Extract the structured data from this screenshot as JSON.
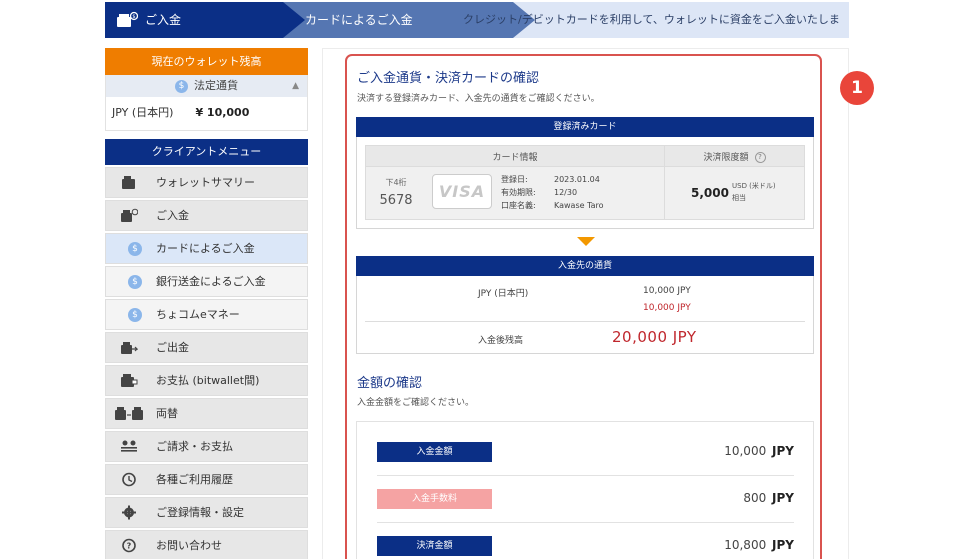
{
  "breadcrumb": {
    "step1": "ご入金",
    "step2": "カードによるご入金",
    "description": "クレジット/デビットカードを利用して、ウォレットに資金をご入金いたします"
  },
  "sidebar": {
    "balance_header": "現在のウォレット残高",
    "currency_type": "法定通貨",
    "balance_currency": "JPY (日本円)",
    "balance_amount": "¥ 10,000",
    "menu_header": "クライアントメニュー",
    "items": [
      {
        "label": "ウォレットサマリー",
        "icon": "wallet-icon"
      },
      {
        "label": "ご入金",
        "icon": "deposit-wallet-icon"
      },
      {
        "label": "カードによるご入金",
        "icon": "coin-icon"
      },
      {
        "label": "銀行送金によるご入金",
        "icon": "coin-icon"
      },
      {
        "label": "ちょコムeマネー",
        "icon": "coin-icon"
      },
      {
        "label": "ご出金",
        "icon": "withdraw-icon"
      },
      {
        "label": "お支払 (bitwallet間)",
        "icon": "transfer-icon"
      },
      {
        "label": "両替",
        "icon": "exchange-icon"
      },
      {
        "label": "ご請求・お支払",
        "icon": "users-icon"
      },
      {
        "label": "各種ご利用履歴",
        "icon": "history-icon"
      },
      {
        "label": "ご登録情報・設定",
        "icon": "gear-icon"
      },
      {
        "label": "お問い合わせ",
        "icon": "question-icon"
      }
    ]
  },
  "section1": {
    "title": "ご入金通貨・決済カードの確認",
    "desc": "決済する登録済みカード、入金先の通貨をご確認ください。",
    "card_bar": "登録済みカード",
    "col_card_info": "カード情報",
    "col_limit": "決済限度額",
    "help_mark": "?",
    "last4_label": "下4桁",
    "last4": "5678",
    "card_brand": "VISA",
    "reg_date_label": "登録日:",
    "reg_date": "2023.01.04",
    "expiry_label": "有効期限:",
    "expiry": "12/30",
    "holder_label": "口座名義:",
    "holder": "Kawase Taro",
    "limit_value": "5,000",
    "limit_unit": "USD (米ドル)",
    "limit_suffix": "相当",
    "currency_bar": "入金先の通貨",
    "currency_label": "JPY (日本円)",
    "current_amount": "10,000 JPY",
    "added_amount": "10,000 JPY",
    "after_label": "入金後残高",
    "after_amount": "20,000 JPY"
  },
  "section2": {
    "title": "金額の確認",
    "desc": "入金金額をご確認ください。",
    "rows": [
      {
        "label": "入金金額",
        "value": "10,000",
        "unit": "JPY"
      },
      {
        "label": "入金手数料",
        "value": "800",
        "unit": "JPY"
      },
      {
        "label": "決済金額",
        "value": "10,800",
        "unit": "JPY"
      }
    ]
  },
  "badge_number": "1",
  "colors": {
    "navy": "#0b2f86",
    "orange": "#ef7d00",
    "red": "#c0272d",
    "highlight": "#d9534f"
  }
}
